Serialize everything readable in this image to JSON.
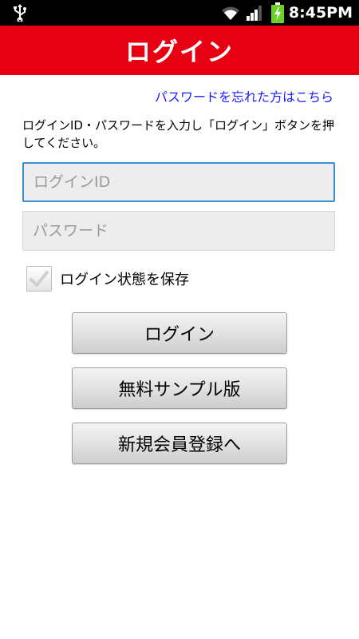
{
  "status_bar": {
    "time": "8:45PM",
    "icons": [
      "usb-icon",
      "wifi-icon",
      "signal-icon",
      "battery-charging-icon"
    ]
  },
  "header": {
    "title": "ログイン"
  },
  "forgot_password": {
    "label": "パスワードを忘れた方はこちら"
  },
  "instructions": {
    "text": "ログインID・パスワードを入力し「ログイン」ボタンを押してください。"
  },
  "form": {
    "login_id": {
      "placeholder": "ログインID",
      "value": ""
    },
    "password": {
      "placeholder": "パスワード",
      "value": ""
    },
    "remember": {
      "label": "ログイン状態を保存",
      "checked": true
    }
  },
  "buttons": {
    "login": "ログイン",
    "free_sample": "無料サンプル版",
    "register": "新規会員登録へ"
  },
  "colors": {
    "header_bg": "#e60012",
    "link": "#1a1aff",
    "focus_border": "#3b8fcf",
    "status_bar_bg": "#000000"
  }
}
